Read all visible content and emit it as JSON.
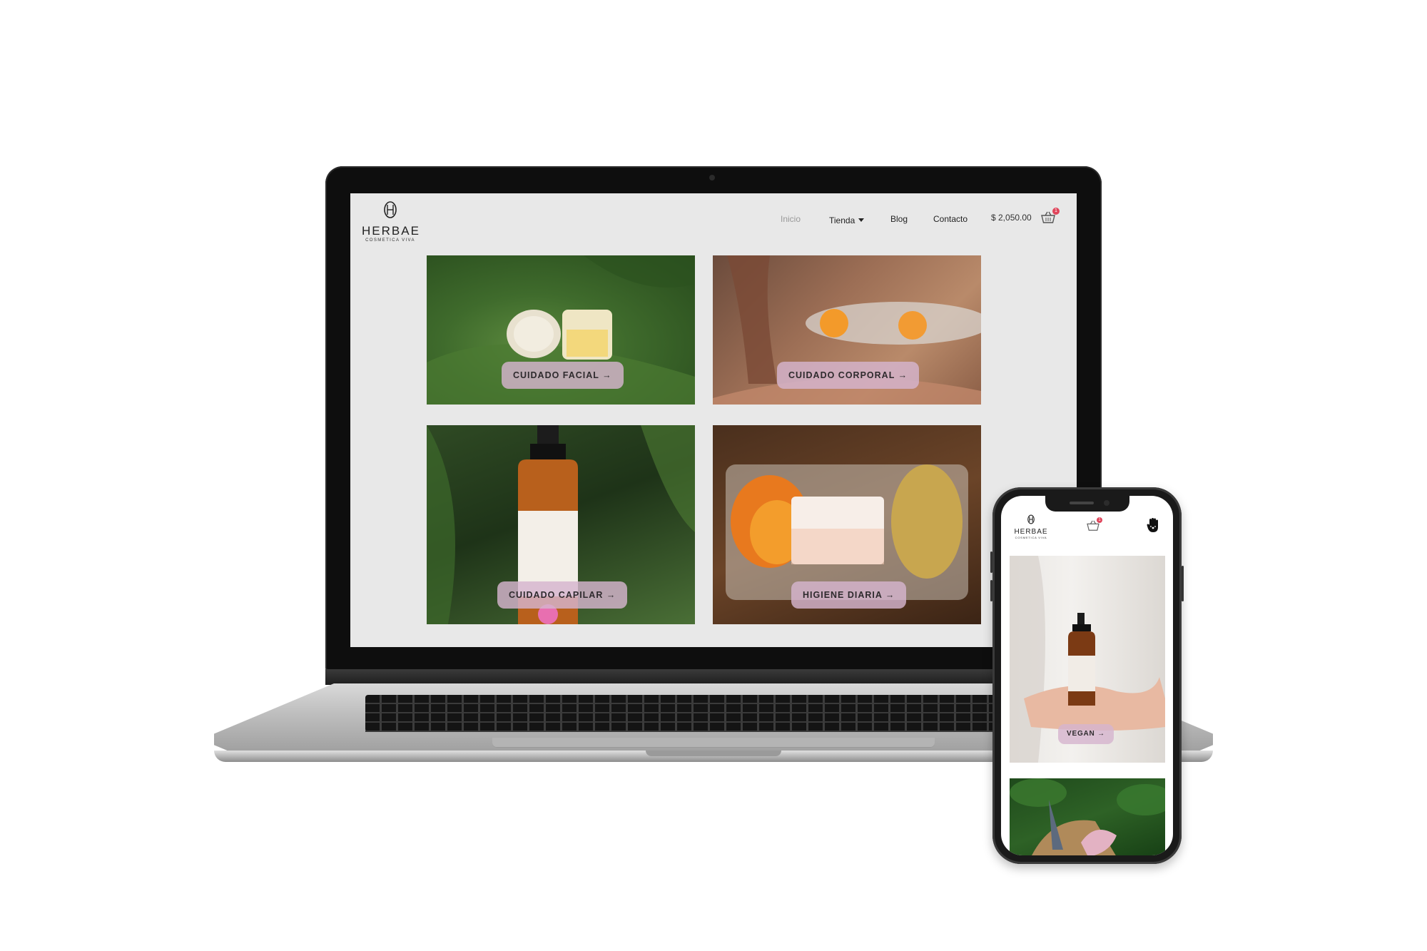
{
  "brand": {
    "name": "HERBAE",
    "tagline": "COSMETICA VIVA"
  },
  "nav": {
    "items": [
      {
        "label": "Inicio",
        "active": true
      },
      {
        "label": "Tienda",
        "dropdown": true
      },
      {
        "label": "Blog"
      },
      {
        "label": "Contacto"
      }
    ],
    "cart_total": "$ 2,050.00",
    "cart_count": "1"
  },
  "categories": [
    {
      "label": "CUIDADO FACIAL →"
    },
    {
      "label": "CUIDADO CORPORAL →"
    },
    {
      "label": "CUIDADO CAPILAR →"
    },
    {
      "label": "HIGIENE DIARIA →"
    }
  ],
  "mobile": {
    "cart_count": "1",
    "menu_icon": "hand-menu-icon",
    "cards": [
      {
        "label": "VEGAN →"
      }
    ]
  },
  "colors": {
    "accent_pink": "#d6b4ce",
    "badge_red": "#e0455b",
    "screen_bg": "#e8e8e8"
  }
}
